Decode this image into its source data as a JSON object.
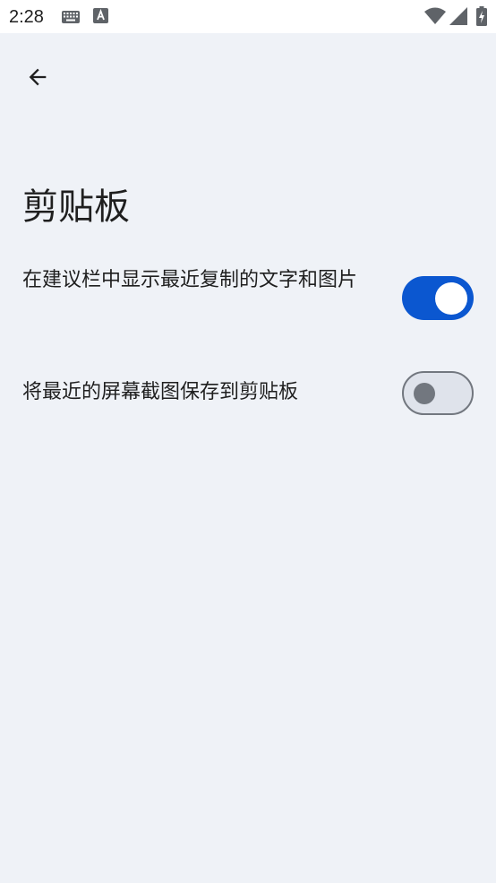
{
  "status_bar": {
    "time": "2:28",
    "icons": [
      "keyboard-icon",
      "font-a-icon",
      "wifi-icon",
      "signal-icon",
      "battery-charging-icon"
    ]
  },
  "header": {
    "back_icon": "arrow-left-icon"
  },
  "page": {
    "title": "剪贴板"
  },
  "settings": [
    {
      "label": "在建议栏中显示最近复制的文字和图片",
      "enabled": true
    },
    {
      "label": "将最近的屏幕截图保存到剪贴板",
      "enabled": false
    }
  ],
  "colors": {
    "background": "#eff2f7",
    "accent": "#0b57d0",
    "toggle_off_track": "#dfe3eb",
    "toggle_off_outline": "#72777f"
  }
}
